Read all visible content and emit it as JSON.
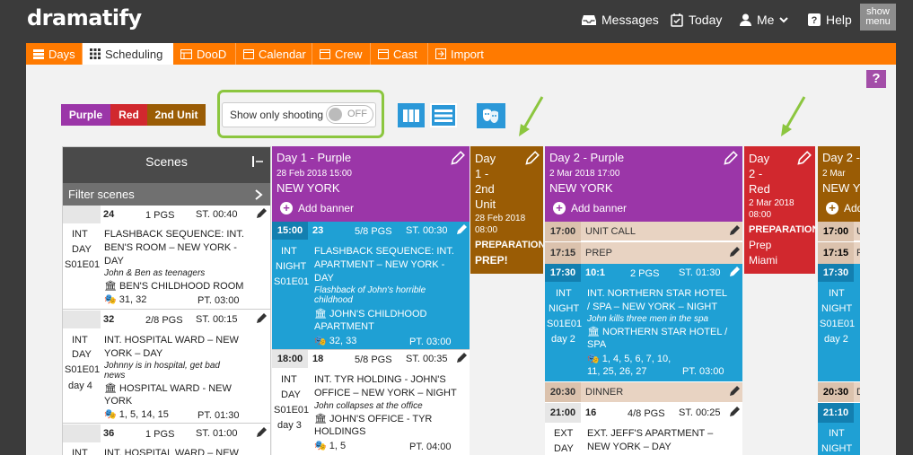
{
  "app": {
    "logo": "dramatify"
  },
  "topnav": {
    "messages": "Messages",
    "today": "Today",
    "me": "Me",
    "help": "Help",
    "showmenu_line1": "show",
    "showmenu_line2": "menu"
  },
  "tabs": [
    "Days",
    "Scheduling",
    "DooD",
    "Calendar",
    "Crew",
    "Cast",
    "Import"
  ],
  "filters": {
    "purple": "Purple",
    "red": "Red",
    "second": "2nd Unit",
    "show_only_shooting": "Show only shooting",
    "toggle": "OFF"
  },
  "help_label": "?",
  "scenes_panel": {
    "title": "Scenes",
    "filter": "Filter scenes",
    "items": [
      {
        "num": "24",
        "pgs": "1 PGS",
        "st": "ST. 00:40",
        "ie": "INT",
        "dn": "DAY",
        "ep": "S01E01",
        "day": "",
        "h1": "FLASHBACK SEQUENCE: INT.",
        "h2": "BEN'S ROOM – NEW YORK -",
        "h3": "DAY",
        "note": "John & Ben as teenagers",
        "loc": "BEN'S CHILDHOOD ROOM",
        "cast": "31, 32",
        "pt": "PT. 03:00"
      },
      {
        "num": "32",
        "pgs": "2/8 PGS",
        "st": "ST. 00:15",
        "ie": "INT",
        "dn": "DAY",
        "ep": "S01E01",
        "day": "day 4",
        "h1": "INT. HOSPITAL WARD – NEW",
        "h2": "YORK – DAY",
        "h3": "",
        "note": "Johnny is in hospital, get bad",
        "note2": "news",
        "loc": "HOSPITAL WARD - NEW",
        "loc2": "YORK",
        "cast": "1, 5, 14, 15",
        "pt": "PT. 01:30"
      },
      {
        "num": "36",
        "pgs": "1 PGS",
        "st": "ST. 01:00",
        "ie": "INT",
        "h1": "INT. HOSPITAL WARD – NEW"
      }
    ]
  },
  "days": [
    {
      "title": "Day 1 - Purple",
      "date": "28 Feb 2018 15:00",
      "place": "NEW YORK",
      "add_banner": "Add banner",
      "rows": [
        {
          "time": "15:00",
          "num": "23",
          "pgs": "5/8 PGS",
          "st": "ST. 00:30",
          "ie": "INT",
          "dn": "NIGHT",
          "ep": "S01E01",
          "h1": "FLASHBACK SEQUENCE: INT.",
          "h2": "APARTMENT – NEW YORK -",
          "h3": "DAY",
          "note1": "Flashback of John's horrible",
          "note2": "childhood",
          "loc1": "JOHN'S CHILDHOOD",
          "loc2": "APARTMENT",
          "cast": "32, 33",
          "pt": "PT. 03:00"
        },
        {
          "time": "18:00",
          "num": "18",
          "pgs": "5/8 PGS",
          "st": "ST. 00:35",
          "ie": "INT",
          "dn": "DAY",
          "ep": "S01E01",
          "day": "day 3",
          "h1": "INT. TYR HOLDING - JOHN'S",
          "h2": "OFFICE – NEW YORK – NIGHT",
          "note1": "John collapses at the office",
          "loc1": "JOHN'S OFFICE - TYR",
          "loc2": "HOLDINGS",
          "cast": "1, 5",
          "pt": "PT. 04:00"
        }
      ]
    },
    {
      "title_l1": "Day",
      "title_l2": "1 -",
      "title_l3": "2nd",
      "title_l4": "Unit",
      "date": "28 Feb 2018",
      "time": "08:00",
      "prep": "PREPARATION:",
      "prep_val": "PREP!"
    },
    {
      "title": "Day 2 - Purple",
      "date": "2 Mar 2018 17:00",
      "place": "NEW YORK",
      "add_banner": "Add banner",
      "rows": [
        {
          "time": "17:00",
          "label": "UNIT CALL"
        },
        {
          "time": "17:15",
          "label": "PREP"
        },
        {
          "time": "17:30",
          "num": "10:1",
          "pgs": "2 PGS",
          "st": "ST. 01:30",
          "ie": "INT",
          "dn": "NIGHT",
          "ep": "S01E01",
          "day": "day 2",
          "h1": "INT. NORTHERN STAR HOTEL",
          "h2": "/ SPA – NEW YORK – NIGHT",
          "note1": "John kills three men in the spa",
          "loc1": "NORTHERN STAR HOTEL /",
          "loc2": "SPA",
          "cast1": "1, 4, 5, 6, 7, 10,",
          "cast2": "11, 25, 26, 27",
          "pt": "PT. 03:00"
        },
        {
          "time": "20:30",
          "label": "DINNER"
        },
        {
          "time": "21:00",
          "num": "16",
          "pgs": "4/8 PGS",
          "st": "ST. 00:25",
          "ie": "EXT",
          "dn": "DAY",
          "h1": "EXT. JEFF'S APARTMENT –",
          "h2": "NEW YORK – DAY"
        }
      ]
    },
    {
      "title_l1": "Day",
      "title_l2": "2 -",
      "title_l3": "Red",
      "date": "2 Mar 2018",
      "time": "08:00",
      "prep": "PREPARATION:",
      "prep_val1": "Prep",
      "prep_val2": "Miami"
    },
    {
      "title": "Day 2 -",
      "date": "2 Mar",
      "place": "NEW Y",
      "add_banner": "Add",
      "rows": [
        {
          "time": "17:00",
          "label": "U"
        },
        {
          "time": "17:15",
          "label": "P"
        },
        {
          "time": "17:30",
          "ie": "INT",
          "dn": "NIGHT",
          "ep": "S01E01",
          "day": "day 2"
        },
        {
          "time": "20:30",
          "label": "D"
        },
        {
          "time": "21:10",
          "ie": "INT",
          "dn": "NIGHT"
        }
      ]
    }
  ],
  "colors": {
    "orange": "#ff7a00",
    "purple": "#9b36a8",
    "red": "#d1282e",
    "brown": "#9a5c05",
    "blue": "#1fa0d4",
    "green": "#8cc63f"
  }
}
